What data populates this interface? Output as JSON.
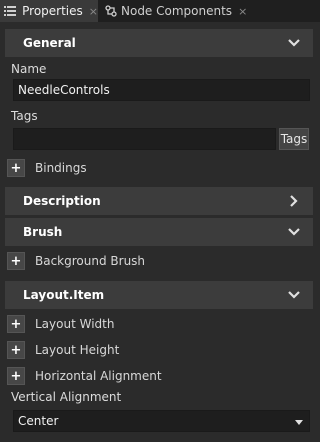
{
  "tabs": [
    {
      "label": "Properties",
      "icon": "list-icon",
      "close": "×"
    },
    {
      "label": "Node Components",
      "icon": "nodes-icon",
      "close": "×"
    }
  ],
  "sections": {
    "general": {
      "title": "General",
      "state": "expanded"
    },
    "description": {
      "title": "Description",
      "state": "collapsed"
    },
    "brush": {
      "title": "Brush",
      "state": "expanded"
    },
    "layout_item": {
      "title": "Layout.Item",
      "state": "expanded"
    }
  },
  "general": {
    "name_label": "Name",
    "name_value": "NeedleControls",
    "tags_label": "Tags",
    "tags_value": "",
    "tags_button": "Tags",
    "bindings": "Bindings"
  },
  "brush": {
    "background_brush": "Background Brush"
  },
  "layout_item": {
    "layout_width": "Layout Width",
    "layout_height": "Layout Height",
    "horizontal_alignment": "Horizontal Alignment",
    "vertical_alignment_label": "Vertical Alignment",
    "vertical_alignment_value": "Center"
  },
  "plus_glyph": "+",
  "colors": {
    "background": "#2b2b2b",
    "section": "#3c3c3c",
    "field": "#1e1e1e"
  }
}
